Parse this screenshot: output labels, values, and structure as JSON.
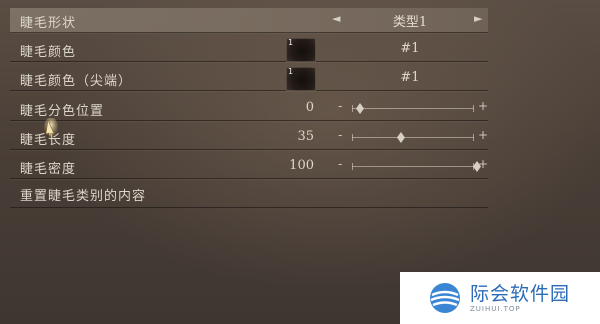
{
  "menu": {
    "shape": {
      "label": "睫毛形状",
      "value": "类型1",
      "left_arrow": "◄",
      "right_arrow": "►"
    },
    "color": {
      "label": "睫毛颜色",
      "swatch_num": "1",
      "value": "#1"
    },
    "tip_color": {
      "label": "睫毛颜色（尖端）",
      "swatch_num": "1",
      "value": "#1"
    },
    "color_position": {
      "label": "睫毛分色位置",
      "value": "0",
      "level": 0
    },
    "length": {
      "label": "睫毛长度",
      "value": "35",
      "level": 35
    },
    "density": {
      "label": "睫毛密度",
      "value": "100",
      "level": 100
    },
    "reset": {
      "label": "重置睫毛类别的内容"
    },
    "slider_minus": "-",
    "slider_plus": "+"
  },
  "watermark": {
    "name": "际会软件园",
    "domain": "ZUIHUI.TOP"
  },
  "colors": {
    "panel_bg": "#4a3f37",
    "selected_row": "#aa9e90",
    "text": "#ddd6ca",
    "watermark_blue": "#2b6cb8"
  }
}
